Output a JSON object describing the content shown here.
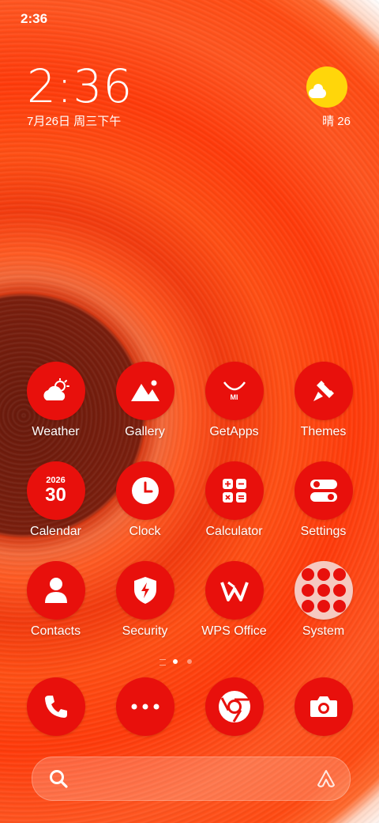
{
  "status_bar": {
    "time": "2:36"
  },
  "clock_widget": {
    "time": "2:36",
    "date": "7月26日 周三下午"
  },
  "weather_widget": {
    "text": "晴 26",
    "icon": "sunny-cloud-icon"
  },
  "apps": [
    {
      "label": "Weather",
      "icon": "weather-icon"
    },
    {
      "label": "Gallery",
      "icon": "gallery-icon"
    },
    {
      "label": "GetApps",
      "icon": "getapps-icon",
      "badge": "MI"
    },
    {
      "label": "Themes",
      "icon": "brush-icon"
    },
    {
      "label": "Calendar",
      "icon": "calendar-icon",
      "year": "2026",
      "day": "30"
    },
    {
      "label": "Clock",
      "icon": "clock-icon"
    },
    {
      "label": "Calculator",
      "icon": "calculator-icon"
    },
    {
      "label": "Settings",
      "icon": "settings-icon"
    },
    {
      "label": "Contacts",
      "icon": "contacts-icon"
    },
    {
      "label": "Security",
      "icon": "security-icon"
    },
    {
      "label": "WPS Office",
      "icon": "wps-icon"
    },
    {
      "label": "System",
      "icon": "folder-icon"
    }
  ],
  "page_indicator": {
    "pages": 3,
    "current": 1
  },
  "dock": [
    {
      "icon": "phone-icon"
    },
    {
      "icon": "more-icon"
    },
    {
      "icon": "chrome-icon"
    },
    {
      "icon": "camera-icon"
    }
  ],
  "search_bar": {
    "icon": "search-icon",
    "assistant_icon": "assistant-icon"
  },
  "colors": {
    "icon_bg": "#e8100c",
    "sun": "#ffd60a",
    "folder_bg": "#f6c9c0"
  }
}
